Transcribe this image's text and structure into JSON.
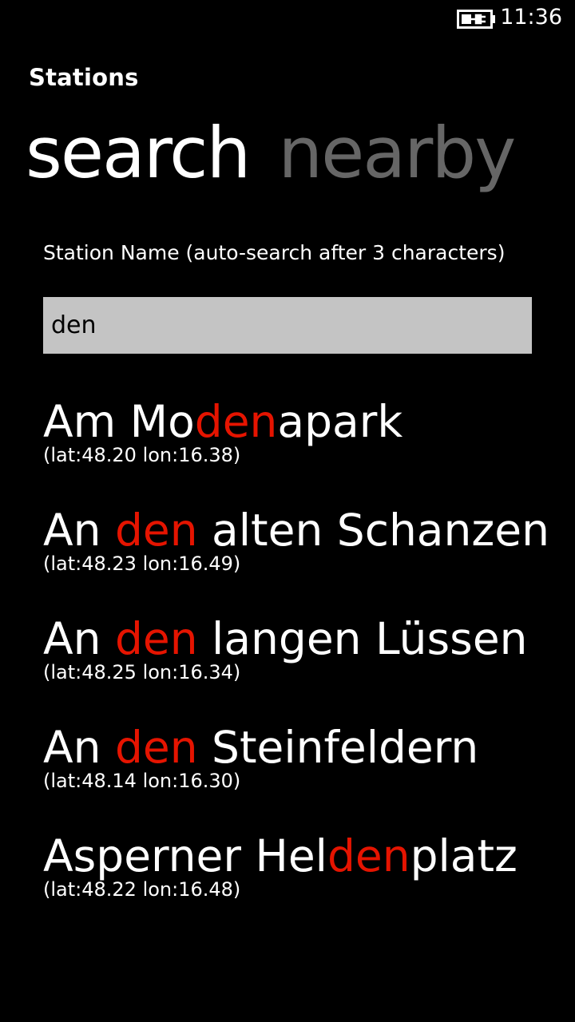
{
  "status_bar": {
    "time": "11:36",
    "battery_icon": "battery-charging-icon"
  },
  "app": {
    "title": "Stations"
  },
  "pivot": {
    "tabs": [
      {
        "label": "search",
        "active": true
      },
      {
        "label": "nearby",
        "active": false
      }
    ]
  },
  "search": {
    "label": "Station Name (auto-search after 3 characters)",
    "value": "den"
  },
  "colors": {
    "highlight": "#e51400",
    "background": "#000000",
    "inactive_tab": "#666666",
    "input_background": "#c4c4c4"
  },
  "results": [
    {
      "name_before": "Am Mo",
      "match": "den",
      "name_after": "apark",
      "coords": "(lat:48.20 lon:16.38)"
    },
    {
      "name_before": "An ",
      "match": "den",
      "name_after": " alten Schanzen",
      "coords": "(lat:48.23 lon:16.49)"
    },
    {
      "name_before": "An ",
      "match": "den",
      "name_after": " langen Lüssen",
      "coords": "(lat:48.25 lon:16.34)"
    },
    {
      "name_before": "An ",
      "match": "den",
      "name_after": " Steinfeldern",
      "coords": "(lat:48.14 lon:16.30)"
    },
    {
      "name_before": "Asperner Hel",
      "match": "den",
      "name_after": "platz",
      "coords": "(lat:48.22 lon:16.48)"
    }
  ]
}
